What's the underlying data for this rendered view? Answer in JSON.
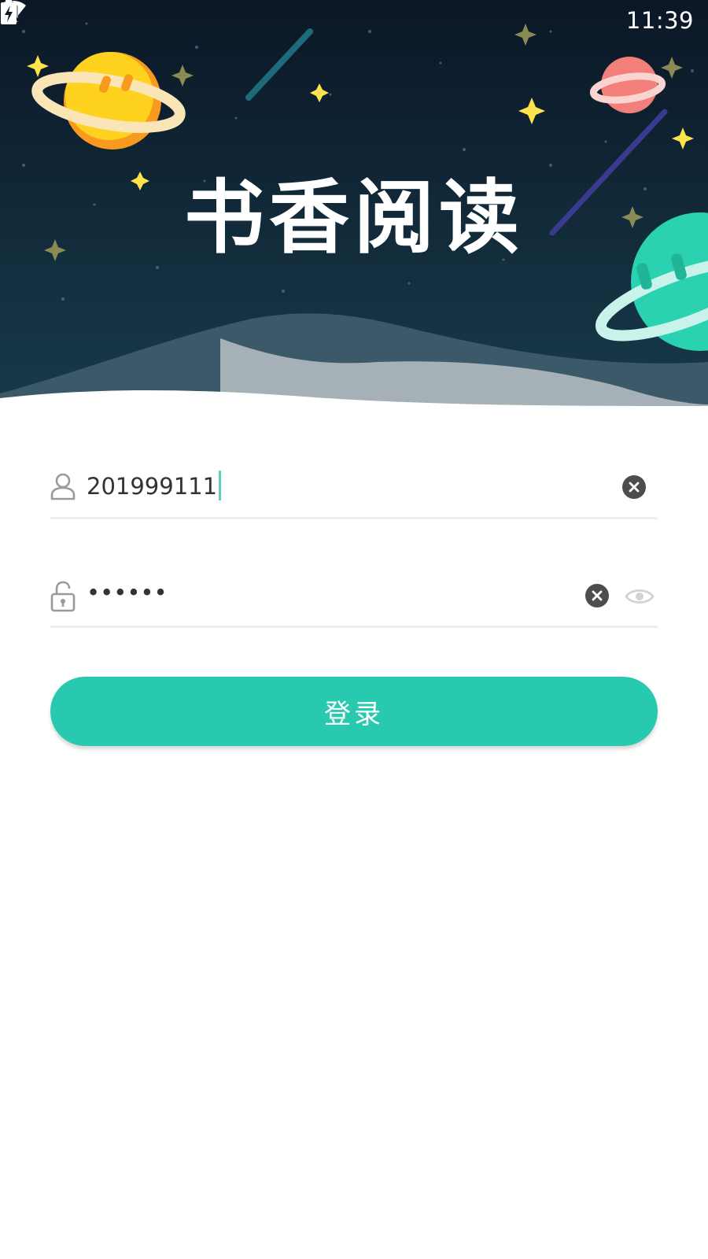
{
  "status_bar": {
    "time": "11:39",
    "icons": [
      "location-icon",
      "wifi-icon",
      "no-sim-icon",
      "battery-charging-icon"
    ]
  },
  "header": {
    "app_title": "书香阅读",
    "colors": {
      "sky_top": "#0b1726",
      "sky_bottom": "#173a4a",
      "star": "#ffe34d"
    }
  },
  "login_form": {
    "username": {
      "value": "201999111",
      "leading_icon": "user-icon",
      "clear_icon": "clear-icon"
    },
    "password": {
      "value": "••••••",
      "leading_icon": "lock-icon",
      "clear_icon": "clear-icon",
      "visibility_icon": "eye-icon"
    },
    "submit_label": "登录",
    "accent_color": "#28c9ae"
  }
}
